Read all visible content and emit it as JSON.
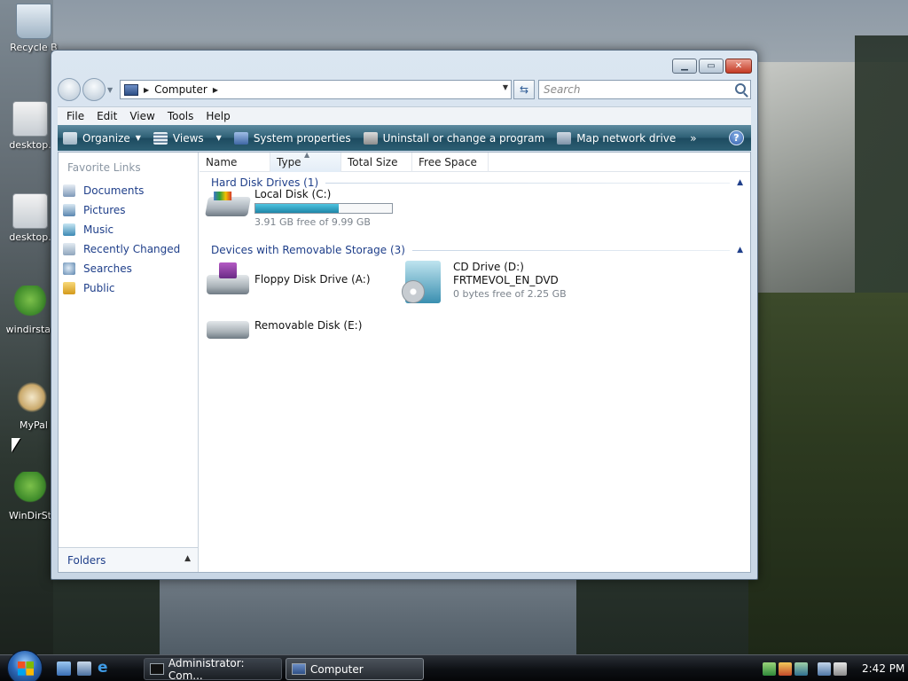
{
  "desktop": {
    "icons": [
      {
        "label": "Recycle B",
        "icon": "recycle-bin-icon"
      },
      {
        "label": "desktop.",
        "icon": "settings-file-icon"
      },
      {
        "label": "desktop.",
        "icon": "settings-file-icon"
      },
      {
        "label": "windirstat",
        "icon": "windirstat-tree-icon"
      },
      {
        "label": "MyPal",
        "icon": "mypal-shortcut-icon"
      },
      {
        "label": "WinDirSt",
        "icon": "windirstat-shortcut-icon"
      }
    ]
  },
  "window": {
    "address": {
      "location": "Computer"
    },
    "search": {
      "placeholder": "Search"
    },
    "menu": [
      "File",
      "Edit",
      "View",
      "Tools",
      "Help"
    ],
    "toolbar": {
      "organize": "Organize",
      "views": "Views",
      "system_properties": "System properties",
      "uninstall": "Uninstall or change a program",
      "map_network": "Map network drive",
      "more": "»",
      "help": "?"
    },
    "nav": {
      "favorite_links_title": "Favorite Links",
      "links": [
        "Documents",
        "Pictures",
        "Music",
        "Recently Changed",
        "Searches",
        "Public"
      ],
      "folders_label": "Folders"
    },
    "columns": [
      "Name",
      "Type",
      "Total Size",
      "Free Space"
    ],
    "groups": {
      "hard_disk": {
        "title": "Hard Disk Drives (1)",
        "drives": [
          {
            "name": "Local Disk (C:)",
            "free_text": "3.91 GB free of 9.99 GB",
            "used_fraction": 0.61
          }
        ]
      },
      "removable": {
        "title": "Devices with Removable Storage (3)",
        "drives": [
          {
            "name": "Floppy Disk Drive (A:)"
          },
          {
            "name": "CD Drive (D:)",
            "volume": "FRTMEVOL_EN_DVD",
            "free_text": "0 bytes free of 2.25 GB"
          },
          {
            "name": "Removable Disk (E:)"
          }
        ]
      }
    }
  },
  "taskbar": {
    "tasks": [
      "Administrator: Com...",
      "Computer"
    ],
    "clock": "2:42 PM"
  }
}
